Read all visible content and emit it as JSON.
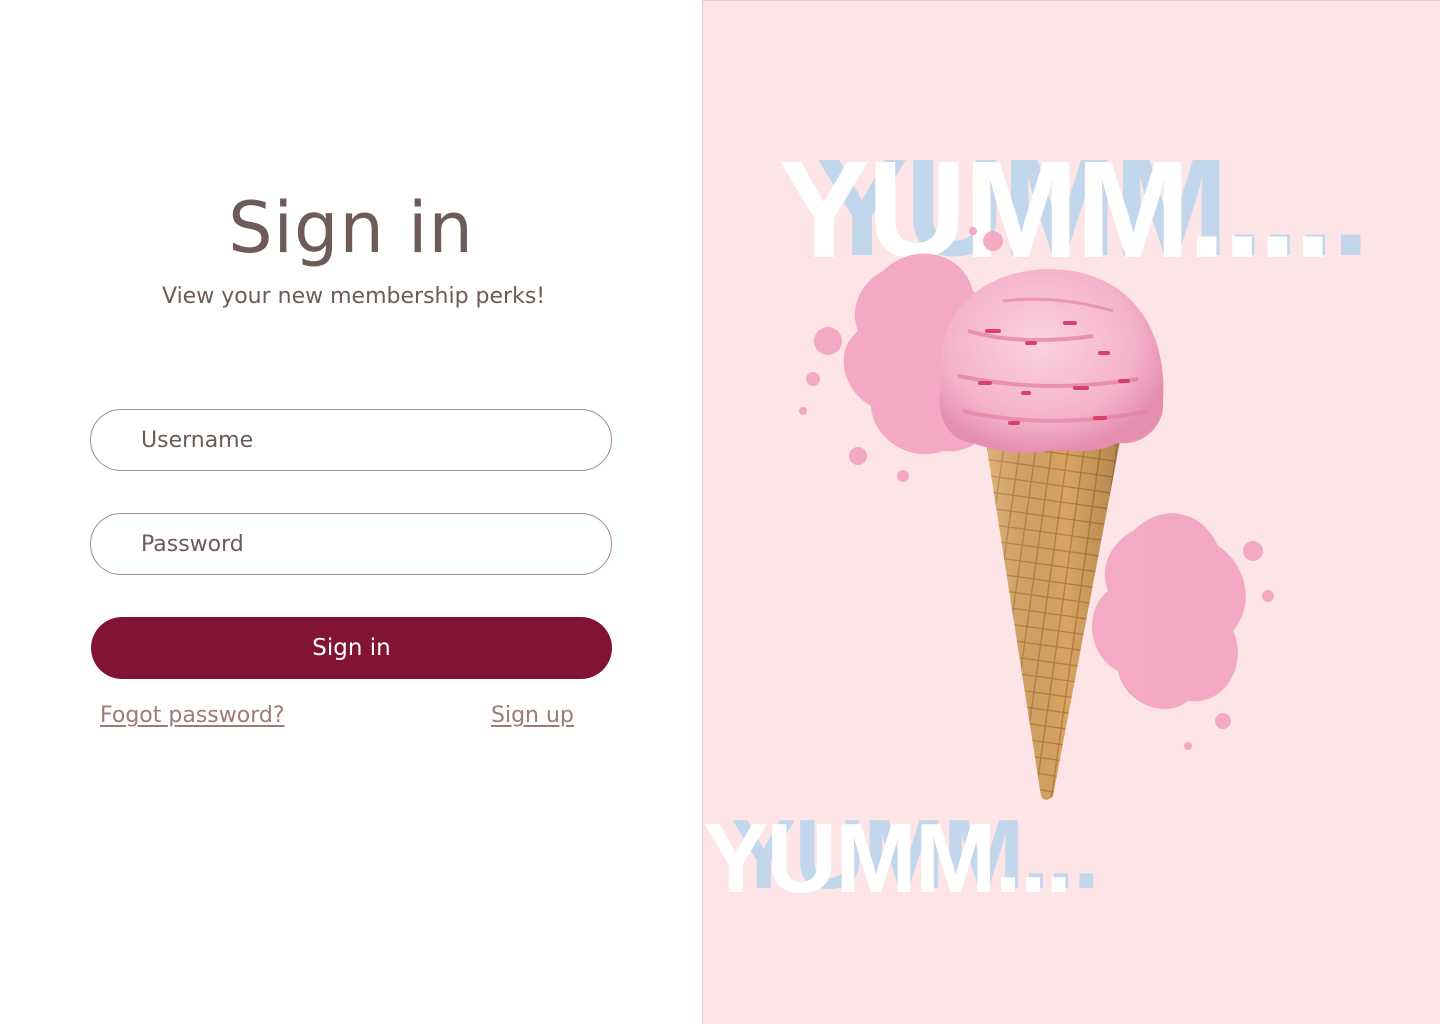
{
  "form": {
    "title": "Sign in",
    "subtitle": "View your new membership perks!",
    "username_placeholder": "Username",
    "password_placeholder": "Password",
    "submit_label": "Sign in",
    "forgot_label": "Fogot password?",
    "signup_label": "Sign up"
  },
  "poster": {
    "headline_top": "YUMM....",
    "headline_bottom": "YUMM...",
    "icon": "ice-cream-cone"
  },
  "colors": {
    "primary": "#821335",
    "text": "#6e5a58",
    "link": "#a07a78",
    "poster_background": "#fde5e7",
    "headline_shadow": "#c2d6ec",
    "ice_cream": "#f4b3cb",
    "splash": "#f3a3c0",
    "cone": "#d8a462"
  }
}
